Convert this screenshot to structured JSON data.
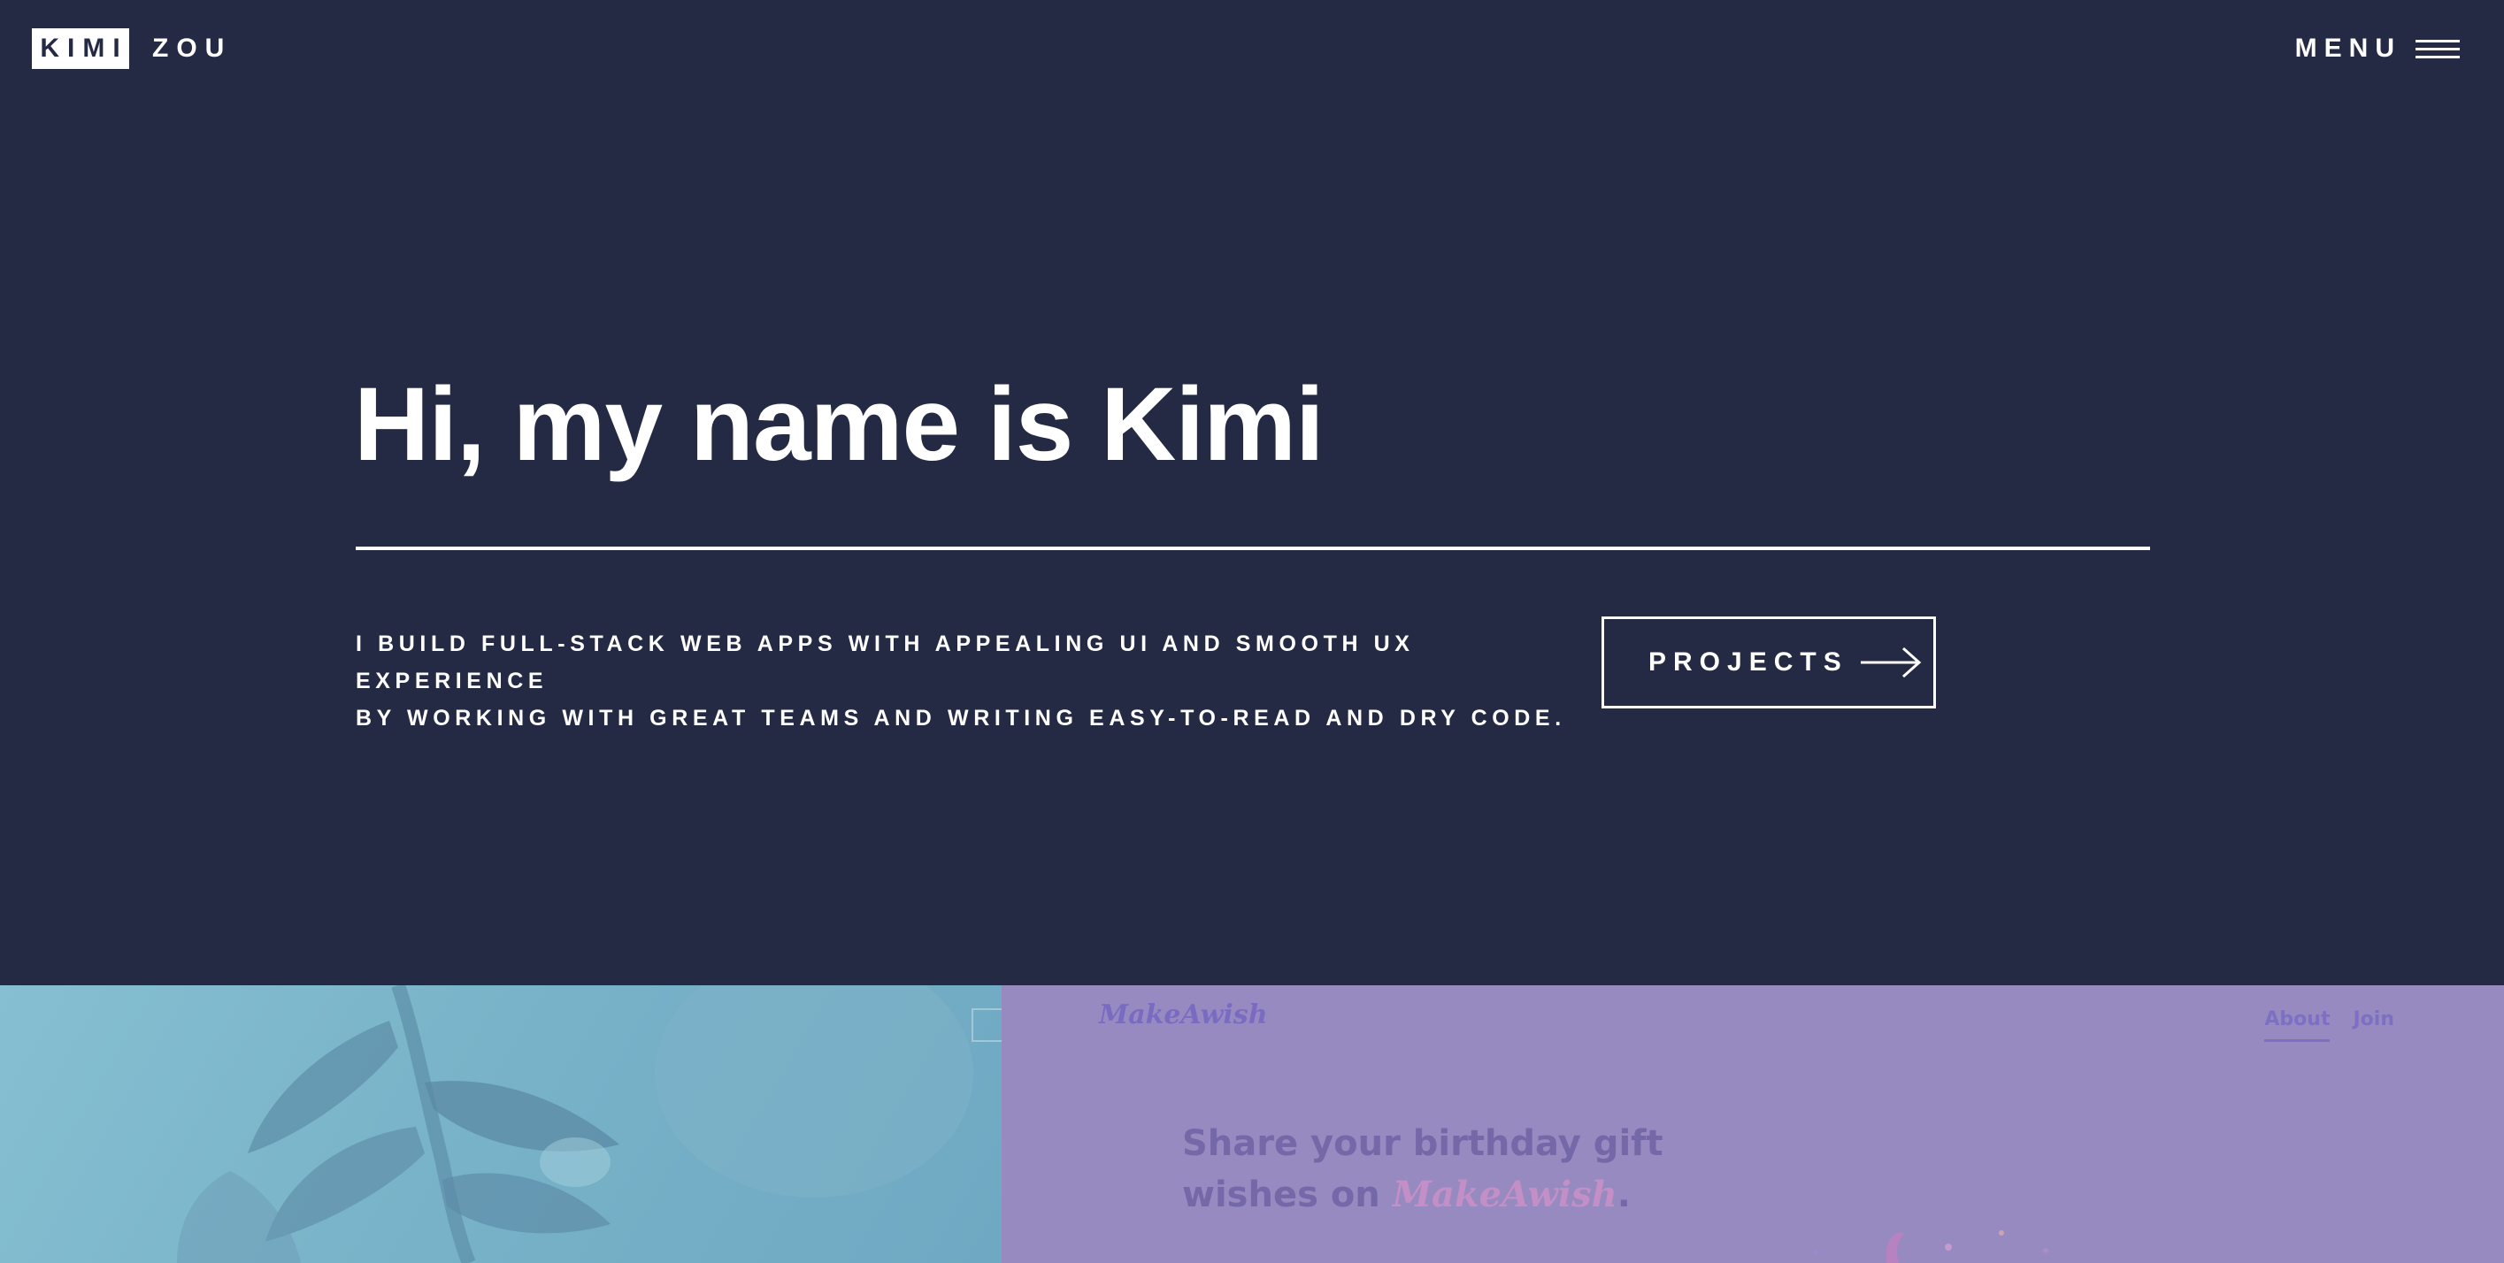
{
  "header": {
    "logo_first": "KIMI",
    "logo_second": "ZOU",
    "menu_label": "MENU"
  },
  "hero": {
    "title": "Hi, my name is Kimi",
    "tagline_line1": "I BUILD FULL-STACK WEB APPS WITH APPEALING UI AND SMOOTH UX EXPERIENCE",
    "tagline_line2": "BY WORKING WITH GREAT TEAMS AND WRITING EASY-TO-READ AND DRY CODE.",
    "cta_label": "PROJECTS",
    "cta_icon": "arrow-right-icon"
  },
  "projects": {
    "left_preview": {
      "icon": "plant-image"
    },
    "right_preview": {
      "logo": "MakeAwish",
      "nav": [
        "About",
        "Join"
      ],
      "active_nav": "About",
      "headline_prefix": "Share your birthday gift wishes on ",
      "headline_brand": "MakeAwish",
      "headline_suffix": "."
    }
  },
  "colors": {
    "background": "#252a44",
    "text": "#ffffff",
    "left_preview": "#7fb6cb",
    "right_preview": "#968ac0",
    "brand_accent": "#c38fc6"
  }
}
